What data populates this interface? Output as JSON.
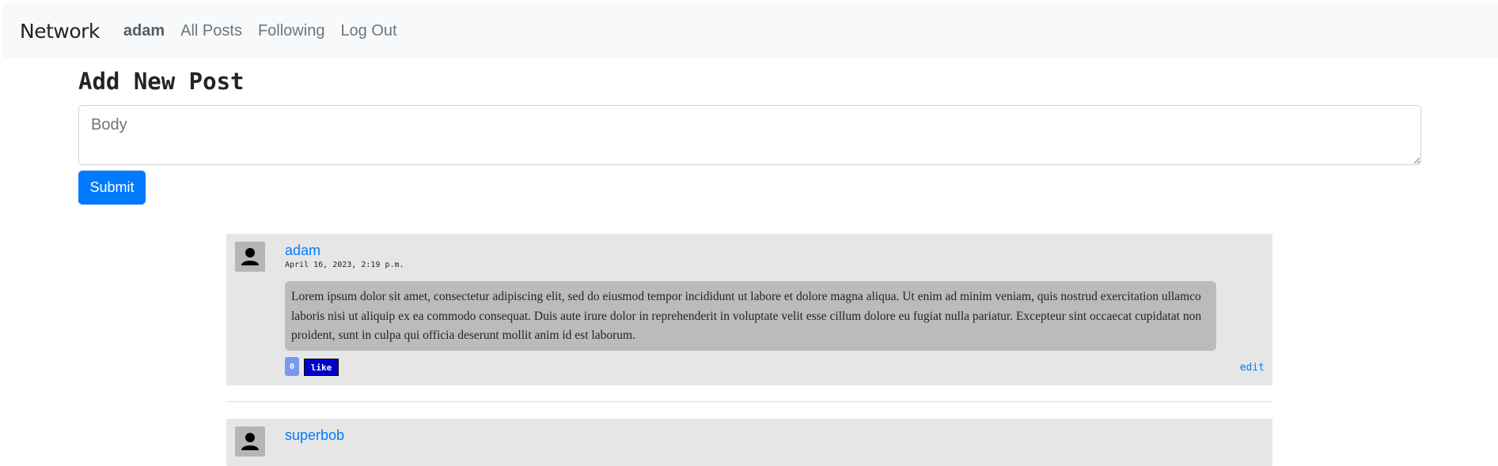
{
  "navbar": {
    "brand": "Network",
    "user": "adam",
    "links": [
      "All Posts",
      "Following",
      "Log Out"
    ]
  },
  "new_post": {
    "title": "Add New Post",
    "body_placeholder": "Body",
    "submit_label": "Submit"
  },
  "posts": [
    {
      "author": "adam",
      "timestamp": "April 16, 2023, 2:19 p.m.",
      "body": "Lorem ipsum dolor sit amet, consectetur adipiscing elit, sed do eiusmod tempor incididunt ut labore et dolore magna aliqua. Ut enim ad minim veniam, quis nostrud exercitation ullamco laboris nisi ut aliquip ex ea commodo consequat. Duis aute irure dolor in reprehenderit in voluptate velit esse cillum dolore eu fugiat nulla pariatur. Excepteur sint occaecat cupidatat non proident, sunt in culpa qui officia deserunt mollit anim id est laborum.",
      "likes": "0",
      "like_label": "like",
      "edit_label": "edit"
    },
    {
      "author": "superbob"
    }
  ],
  "colors": {
    "navbar_bg": "#f8f9fa",
    "primary": "#007bff",
    "post_bg": "#e6e6e6",
    "post_body_bg": "#bbbbbb",
    "like_button": "#0000cc",
    "like_count_badge": "#7a98ef"
  },
  "icons": {
    "avatar": "user-silhouette-icon"
  }
}
